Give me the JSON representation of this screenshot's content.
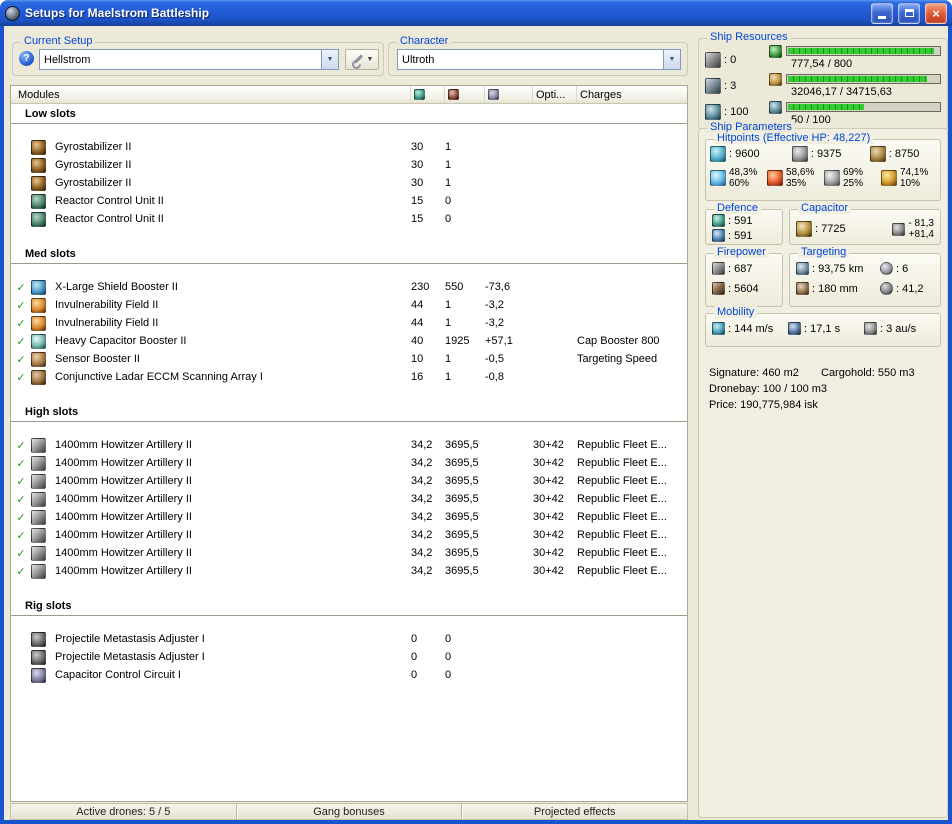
{
  "window": {
    "title": "Setups for Maelstrom Battleship"
  },
  "current_setup": {
    "label": "Current Setup",
    "value": "Hellstrom"
  },
  "character": {
    "label": "Character",
    "value": "Ultroth"
  },
  "modules": {
    "header": {
      "title": "Modules",
      "opti": "Opti...",
      "charges": "Charges"
    },
    "sections": [
      {
        "title": "Low slots",
        "rows": [
          {
            "check": false,
            "icon": "gyrostabilizer",
            "name": "Gyrostabilizer II",
            "cpu": "30",
            "pg": "1",
            "cap": "",
            "opti": "",
            "charges": ""
          },
          {
            "check": false,
            "icon": "gyrostabilizer",
            "name": "Gyrostabilizer II",
            "cpu": "30",
            "pg": "1",
            "cap": "",
            "opti": "",
            "charges": ""
          },
          {
            "check": false,
            "icon": "gyrostabilizer",
            "name": "Gyrostabilizer II",
            "cpu": "30",
            "pg": "1",
            "cap": "",
            "opti": "",
            "charges": ""
          },
          {
            "check": false,
            "icon": "reactor-control",
            "name": "Reactor Control Unit II",
            "cpu": "15",
            "pg": "0",
            "cap": "",
            "opti": "",
            "charges": ""
          },
          {
            "check": false,
            "icon": "reactor-control",
            "name": "Reactor Control Unit II",
            "cpu": "15",
            "pg": "0",
            "cap": "",
            "opti": "",
            "charges": ""
          }
        ]
      },
      {
        "title": "Med slots",
        "rows": [
          {
            "check": true,
            "icon": "shield-booster",
            "name": "X-Large Shield Booster II",
            "cpu": "230",
            "pg": "550",
            "cap": "-73,6",
            "opti": "",
            "charges": ""
          },
          {
            "check": true,
            "icon": "invuln-field",
            "name": "Invulnerability Field II",
            "cpu": "44",
            "pg": "1",
            "cap": "-3,2",
            "opti": "",
            "charges": ""
          },
          {
            "check": true,
            "icon": "invuln-field",
            "name": "Invulnerability Field II",
            "cpu": "44",
            "pg": "1",
            "cap": "-3,2",
            "opti": "",
            "charges": ""
          },
          {
            "check": true,
            "icon": "cap-booster",
            "name": "Heavy Capacitor Booster II",
            "cpu": "40",
            "pg": "1925",
            "cap": "+57,1",
            "opti": "",
            "charges": "Cap Booster 800"
          },
          {
            "check": true,
            "icon": "sensor-booster",
            "name": "Sensor Booster II",
            "cpu": "10",
            "pg": "1",
            "cap": "-0,5",
            "opti": "",
            "charges": "Targeting Speed"
          },
          {
            "check": true,
            "icon": "eccm",
            "name": "Conjunctive Ladar ECCM Scanning Array I",
            "cpu": "16",
            "pg": "1",
            "cap": "-0,8",
            "opti": "",
            "charges": ""
          }
        ]
      },
      {
        "title": "High slots",
        "rows": [
          {
            "check": true,
            "icon": "artillery",
            "name": "1400mm Howitzer Artillery II",
            "cpu": "34,2",
            "pg": "3695,5",
            "cap": "",
            "opti": "30+42",
            "charges": "Republic Fleet E..."
          },
          {
            "check": true,
            "icon": "artillery",
            "name": "1400mm Howitzer Artillery II",
            "cpu": "34,2",
            "pg": "3695,5",
            "cap": "",
            "opti": "30+42",
            "charges": "Republic Fleet E..."
          },
          {
            "check": true,
            "icon": "artillery",
            "name": "1400mm Howitzer Artillery II",
            "cpu": "34,2",
            "pg": "3695,5",
            "cap": "",
            "opti": "30+42",
            "charges": "Republic Fleet E..."
          },
          {
            "check": true,
            "icon": "artillery",
            "name": "1400mm Howitzer Artillery II",
            "cpu": "34,2",
            "pg": "3695,5",
            "cap": "",
            "opti": "30+42",
            "charges": "Republic Fleet E..."
          },
          {
            "check": true,
            "icon": "artillery",
            "name": "1400mm Howitzer Artillery II",
            "cpu": "34,2",
            "pg": "3695,5",
            "cap": "",
            "opti": "30+42",
            "charges": "Republic Fleet E..."
          },
          {
            "check": true,
            "icon": "artillery",
            "name": "1400mm Howitzer Artillery II",
            "cpu": "34,2",
            "pg": "3695,5",
            "cap": "",
            "opti": "30+42",
            "charges": "Republic Fleet E..."
          },
          {
            "check": true,
            "icon": "artillery",
            "name": "1400mm Howitzer Artillery II",
            "cpu": "34,2",
            "pg": "3695,5",
            "cap": "",
            "opti": "30+42",
            "charges": "Republic Fleet E..."
          },
          {
            "check": true,
            "icon": "artillery",
            "name": "1400mm Howitzer Artillery II",
            "cpu": "34,2",
            "pg": "3695,5",
            "cap": "",
            "opti": "30+42",
            "charges": "Republic Fleet E..."
          }
        ]
      },
      {
        "title": "Rig slots",
        "rows": [
          {
            "check": false,
            "icon": "rig-projectile",
            "name": "Projectile Metastasis Adjuster I",
            "cpu": "0",
            "pg": "0",
            "cap": "",
            "opti": "",
            "charges": ""
          },
          {
            "check": false,
            "icon": "rig-projectile",
            "name": "Projectile Metastasis Adjuster I",
            "cpu": "0",
            "pg": "0",
            "cap": "",
            "opti": "",
            "charges": ""
          },
          {
            "check": false,
            "icon": "rig-capacitor",
            "name": "Capacitor Control Circuit I",
            "cpu": "0",
            "pg": "0",
            "cap": "",
            "opti": "",
            "charges": ""
          }
        ]
      }
    ]
  },
  "status_bar": {
    "active_drones": "Active drones: 5 / 5",
    "gang_bonuses": "Gang bonuses",
    "projected_effects": "Projected effects"
  },
  "ship_resources": {
    "label": "Ship Resources",
    "turrets": ": 0",
    "launchers": ": 3",
    "drones": ": 100",
    "cpu": {
      "text": "777,54 / 800",
      "pct": 97
    },
    "powergrid": {
      "text": "32046,17 / 34715,63",
      "pct": 92
    },
    "calibration": {
      "text": "50 / 100",
      "pct": 50
    }
  },
  "ship_parameters": {
    "label": "Ship Parameters",
    "hitpoints": {
      "label": "Hitpoints (Effective HP: 48,227)",
      "shield": ": 9600",
      "armor": ": 9375",
      "hull": ": 8750",
      "resists": [
        {
          "type": "em",
          "shield": "48,3%",
          "armor": "60%"
        },
        {
          "type": "thermal",
          "shield": "58,6%",
          "armor": "35%"
        },
        {
          "type": "kinetic",
          "shield": "69%",
          "armor": "25%"
        },
        {
          "type": "explosive",
          "shield": "74,1%",
          "armor": "10%"
        }
      ]
    },
    "defence": {
      "label": "Defence",
      "line1": ": 591",
      "line2": ": 591"
    },
    "capacitor": {
      "label": "Capacitor",
      "amount": ": 7725",
      "drain": "- 81,3",
      "recharge": "+81,4"
    },
    "firepower": {
      "label": "Firepower",
      "dps": ": 687",
      "volley": ": 5604"
    },
    "targeting": {
      "label": "Targeting",
      "range": ": 93,75 km",
      "max_targets": ": 6",
      "scan_res": ": 180 mm",
      "sensor_str": ": 41,2"
    },
    "mobility": {
      "label": "Mobility",
      "speed": ": 144 m/s",
      "align": ": 17,1 s",
      "warp": ": 3 au/s"
    },
    "signature": "Signature: 460 m2",
    "cargohold": "Cargohold: 550 m3",
    "dronebay": "Dronebay: 100 / 100 m3",
    "price": "Price: 190,775,984 isk"
  }
}
